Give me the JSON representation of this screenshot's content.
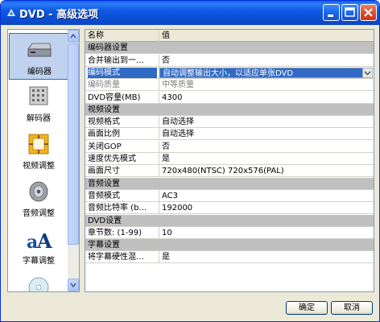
{
  "window": {
    "title": "DVD - 高级选项"
  },
  "sidebar": {
    "items": [
      {
        "label": "编码器",
        "icon": "encoder-icon",
        "selected": true
      },
      {
        "label": "解码器",
        "icon": "decoder-icon",
        "selected": false
      },
      {
        "label": "视频调整",
        "icon": "video-adjust-icon",
        "selected": false
      },
      {
        "label": "音频调整",
        "icon": "speaker-icon",
        "selected": false
      },
      {
        "label": "字幕调整",
        "icon": "subtitle-icon",
        "selected": false
      }
    ]
  },
  "grid": {
    "header": {
      "name": "名称",
      "value": "值"
    },
    "rows": [
      {
        "type": "section",
        "name": "编码器设置",
        "value": ""
      },
      {
        "type": "item",
        "name": "合并输出到一…",
        "value": "否"
      },
      {
        "type": "selected",
        "name": "编码模式",
        "value": "自动调整输出大小，以适应单张DVD"
      },
      {
        "type": "disabled",
        "name": "编码质量",
        "value": "中等质量"
      },
      {
        "type": "item",
        "name": "DVD容量(MB)",
        "value": "4300"
      },
      {
        "type": "section",
        "name": "视频设置",
        "value": ""
      },
      {
        "type": "item",
        "name": "视频格式",
        "value": "自动选择"
      },
      {
        "type": "item",
        "name": "画面比例",
        "value": "自动选择"
      },
      {
        "type": "item",
        "name": "关闭GOP",
        "value": "否"
      },
      {
        "type": "item",
        "name": "速度优先模式",
        "value": "是"
      },
      {
        "type": "item",
        "name": "画面尺寸",
        "value": "720x480(NTSC) 720x576(PAL)"
      },
      {
        "type": "section",
        "name": "音频设置",
        "value": ""
      },
      {
        "type": "item",
        "name": "音频模式",
        "value": "AC3"
      },
      {
        "type": "item",
        "name": "音频比特率 (b…",
        "value": "192000"
      },
      {
        "type": "section",
        "name": "DVD设置",
        "value": ""
      },
      {
        "type": "item",
        "name": "章节数: (1-99)",
        "value": "10"
      },
      {
        "type": "section",
        "name": "字幕设置",
        "value": ""
      },
      {
        "type": "item",
        "name": "将字幕硬性混…",
        "value": "是"
      }
    ]
  },
  "buttons": {
    "ok": "确定",
    "cancel": "取消"
  },
  "colors": {
    "titlebar": "#0a4fd6",
    "selection": "#316ac5",
    "section_bg": "#c0c0c0",
    "dialog_bg": "#ece9d8"
  }
}
